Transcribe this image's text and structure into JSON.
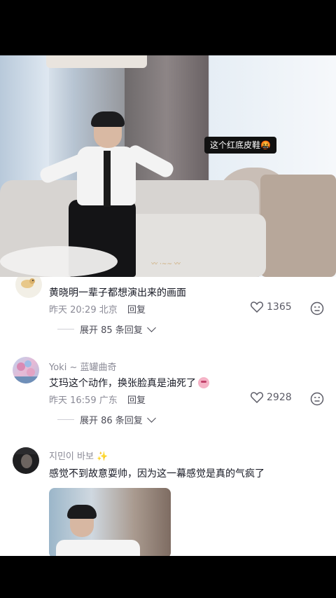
{
  "video": {
    "overlay_label": "这个红底皮鞋",
    "overlay_emoji": "🤬",
    "watermark": "〰 ·~~ 〰"
  },
  "comments": [
    {
      "username": " ",
      "text": "黄晓明一辈子都想演出来的画面",
      "time": "昨天 20:29",
      "location": "北京",
      "reply_label": "回复",
      "likes": "1365",
      "expand_label": "展开 85 条回复"
    },
    {
      "username": "Yoki ~ 蓝罐曲奇",
      "text": "艾玛这个动作，换张脸真是油死了",
      "time": "昨天 16:59",
      "location": "广东",
      "reply_label": "回复",
      "likes": "2928",
      "expand_label": "展开 86 条回复"
    },
    {
      "username": "지민이 바보",
      "text": "感觉不到故意耍帅，因为这一幕感觉是真的气疯了"
    }
  ]
}
